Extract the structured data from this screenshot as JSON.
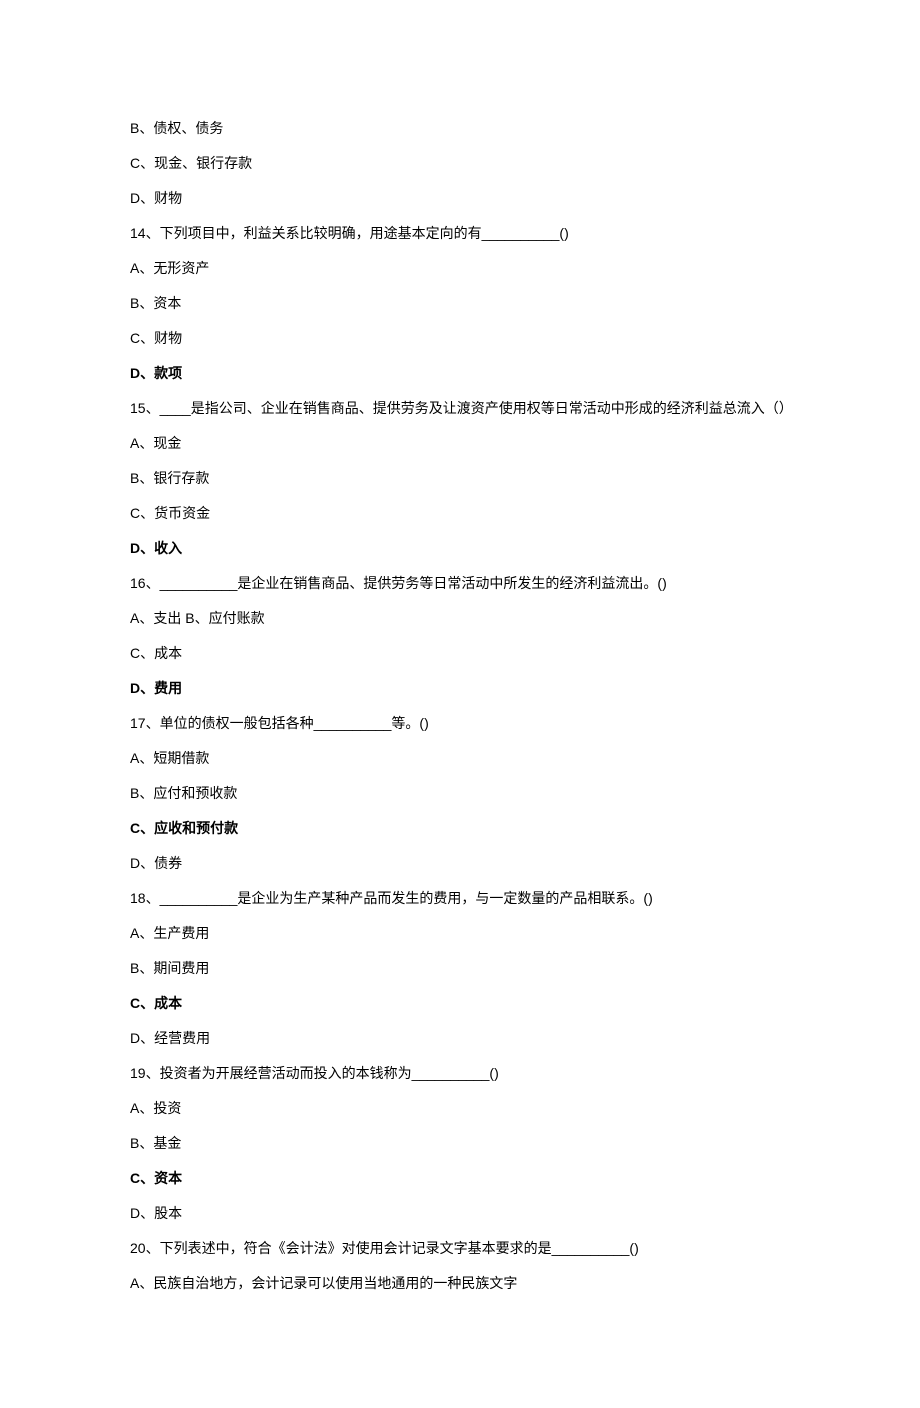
{
  "lines": [
    {
      "text": "B、债权、债务",
      "bold": false
    },
    {
      "text": "C、现金、银行存款",
      "bold": false
    },
    {
      "text": "D、财物",
      "bold": false
    },
    {
      "text": "14、下列项目中，利益关系比较明确，用途基本定向的有__________()",
      "bold": false
    },
    {
      "text": "A、无形资产",
      "bold": false
    },
    {
      "text": "B、资本",
      "bold": false
    },
    {
      "text": "C、财物",
      "bold": false
    },
    {
      "text": "D、款项",
      "bold": true
    },
    {
      "text": "15、____是指公司、企业在销售商品、提供劳务及让渡资产使用权等日常活动中形成的经济利益总流入（）",
      "bold": false
    },
    {
      "text": "A、现金",
      "bold": false
    },
    {
      "text": "B、银行存款",
      "bold": false
    },
    {
      "text": "C、货币资金",
      "bold": false
    },
    {
      "text": "D、收入",
      "bold": true
    },
    {
      "text": "16、__________是企业在销售商品、提供劳务等日常活动中所发生的经济利益流出。()",
      "bold": false
    },
    {
      "text": "A、支出 B、应付账款",
      "bold": false
    },
    {
      "text": "C、成本",
      "bold": false
    },
    {
      "text": "D、费用",
      "bold": true
    },
    {
      "text": "17、单位的债权一般包括各种__________等。()",
      "bold": false
    },
    {
      "text": "A、短期借款",
      "bold": false
    },
    {
      "text": "B、应付和预收款",
      "bold": false
    },
    {
      "text": "C、应收和预付款",
      "bold": true
    },
    {
      "text": "D、债券",
      "bold": false
    },
    {
      "text": "18、__________是企业为生产某种产品而发生的费用，与一定数量的产品相联系。()",
      "bold": false
    },
    {
      "text": "A、生产费用",
      "bold": false
    },
    {
      "text": "B、期间费用",
      "bold": false
    },
    {
      "text": "C、成本",
      "bold": true
    },
    {
      "text": "D、经营费用",
      "bold": false
    },
    {
      "text": "19、投资者为开展经营活动而投入的本钱称为__________()",
      "bold": false
    },
    {
      "text": "A、投资",
      "bold": false
    },
    {
      "text": "B、基金",
      "bold": false
    },
    {
      "text": "C、资本",
      "bold": true
    },
    {
      "text": "D、股本",
      "bold": false
    },
    {
      "text": "20、下列表述中，符合《会计法》对使用会计记录文字基本要求的是__________()",
      "bold": false
    },
    {
      "text": "A、民族自治地方，会计记录可以使用当地通用的一种民族文字",
      "bold": false
    }
  ]
}
